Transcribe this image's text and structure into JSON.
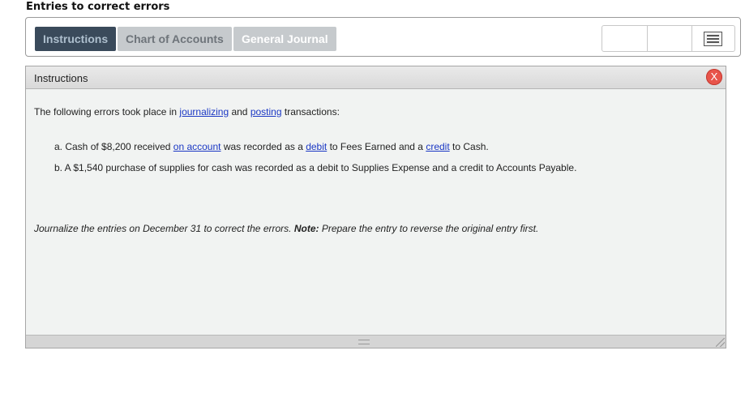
{
  "page_title": "Entries to correct errors",
  "tabs": [
    {
      "label": "Instructions"
    },
    {
      "label": "Chart of Accounts"
    },
    {
      "label": "General Journal"
    }
  ],
  "toolbar": {
    "menu_icon": "hamburger-menu-icon"
  },
  "panel": {
    "title": "Instructions",
    "close_label": "X",
    "intro": {
      "t1": "The following errors took place in ",
      "link1": "journalizing",
      "t2": " and ",
      "link2": "posting",
      "t3": " transactions:"
    },
    "item_a": {
      "prefix": "a.  Cash of $8,200 received ",
      "link1": "on account",
      "t2": " was recorded as a ",
      "link2": "debit",
      "t3": " to Fees Earned and a ",
      "link3": "credit",
      "t4": " to Cash."
    },
    "item_b": "b.  A $1,540 purchase of supplies for cash was recorded as a debit to Supplies Expense and a credit to Accounts Payable.",
    "closing": {
      "t1": "Journalize the entries on December 31 to correct the errors. ",
      "bold": "Note:",
      "t2": " Prepare the entry to reverse the original entry first."
    }
  },
  "colors": {
    "active_tab": "#3a4a5b",
    "inactive_tab": "#c6cacd",
    "link": "#1a37c4",
    "close": "#e8544a"
  }
}
